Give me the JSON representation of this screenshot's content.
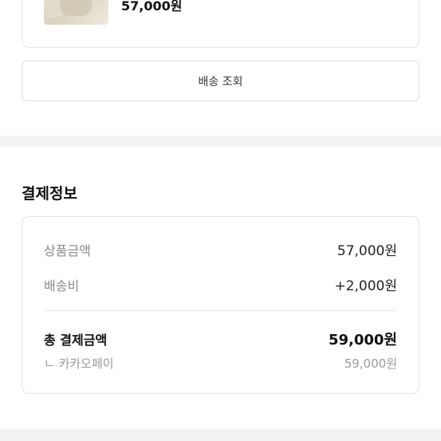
{
  "product": {
    "price": "57,000원"
  },
  "delivery_button": {
    "label": "배송 조회"
  },
  "payment": {
    "title": "결제정보",
    "goods_label": "상품금액",
    "goods_value": "57,000원",
    "shipping_label": "배송비",
    "shipping_value": "+2,000원",
    "total_label": "총 결제금액",
    "total_value": "59,000원",
    "method_label": "ㄴ 카카오페이",
    "method_value": "59,000원"
  }
}
